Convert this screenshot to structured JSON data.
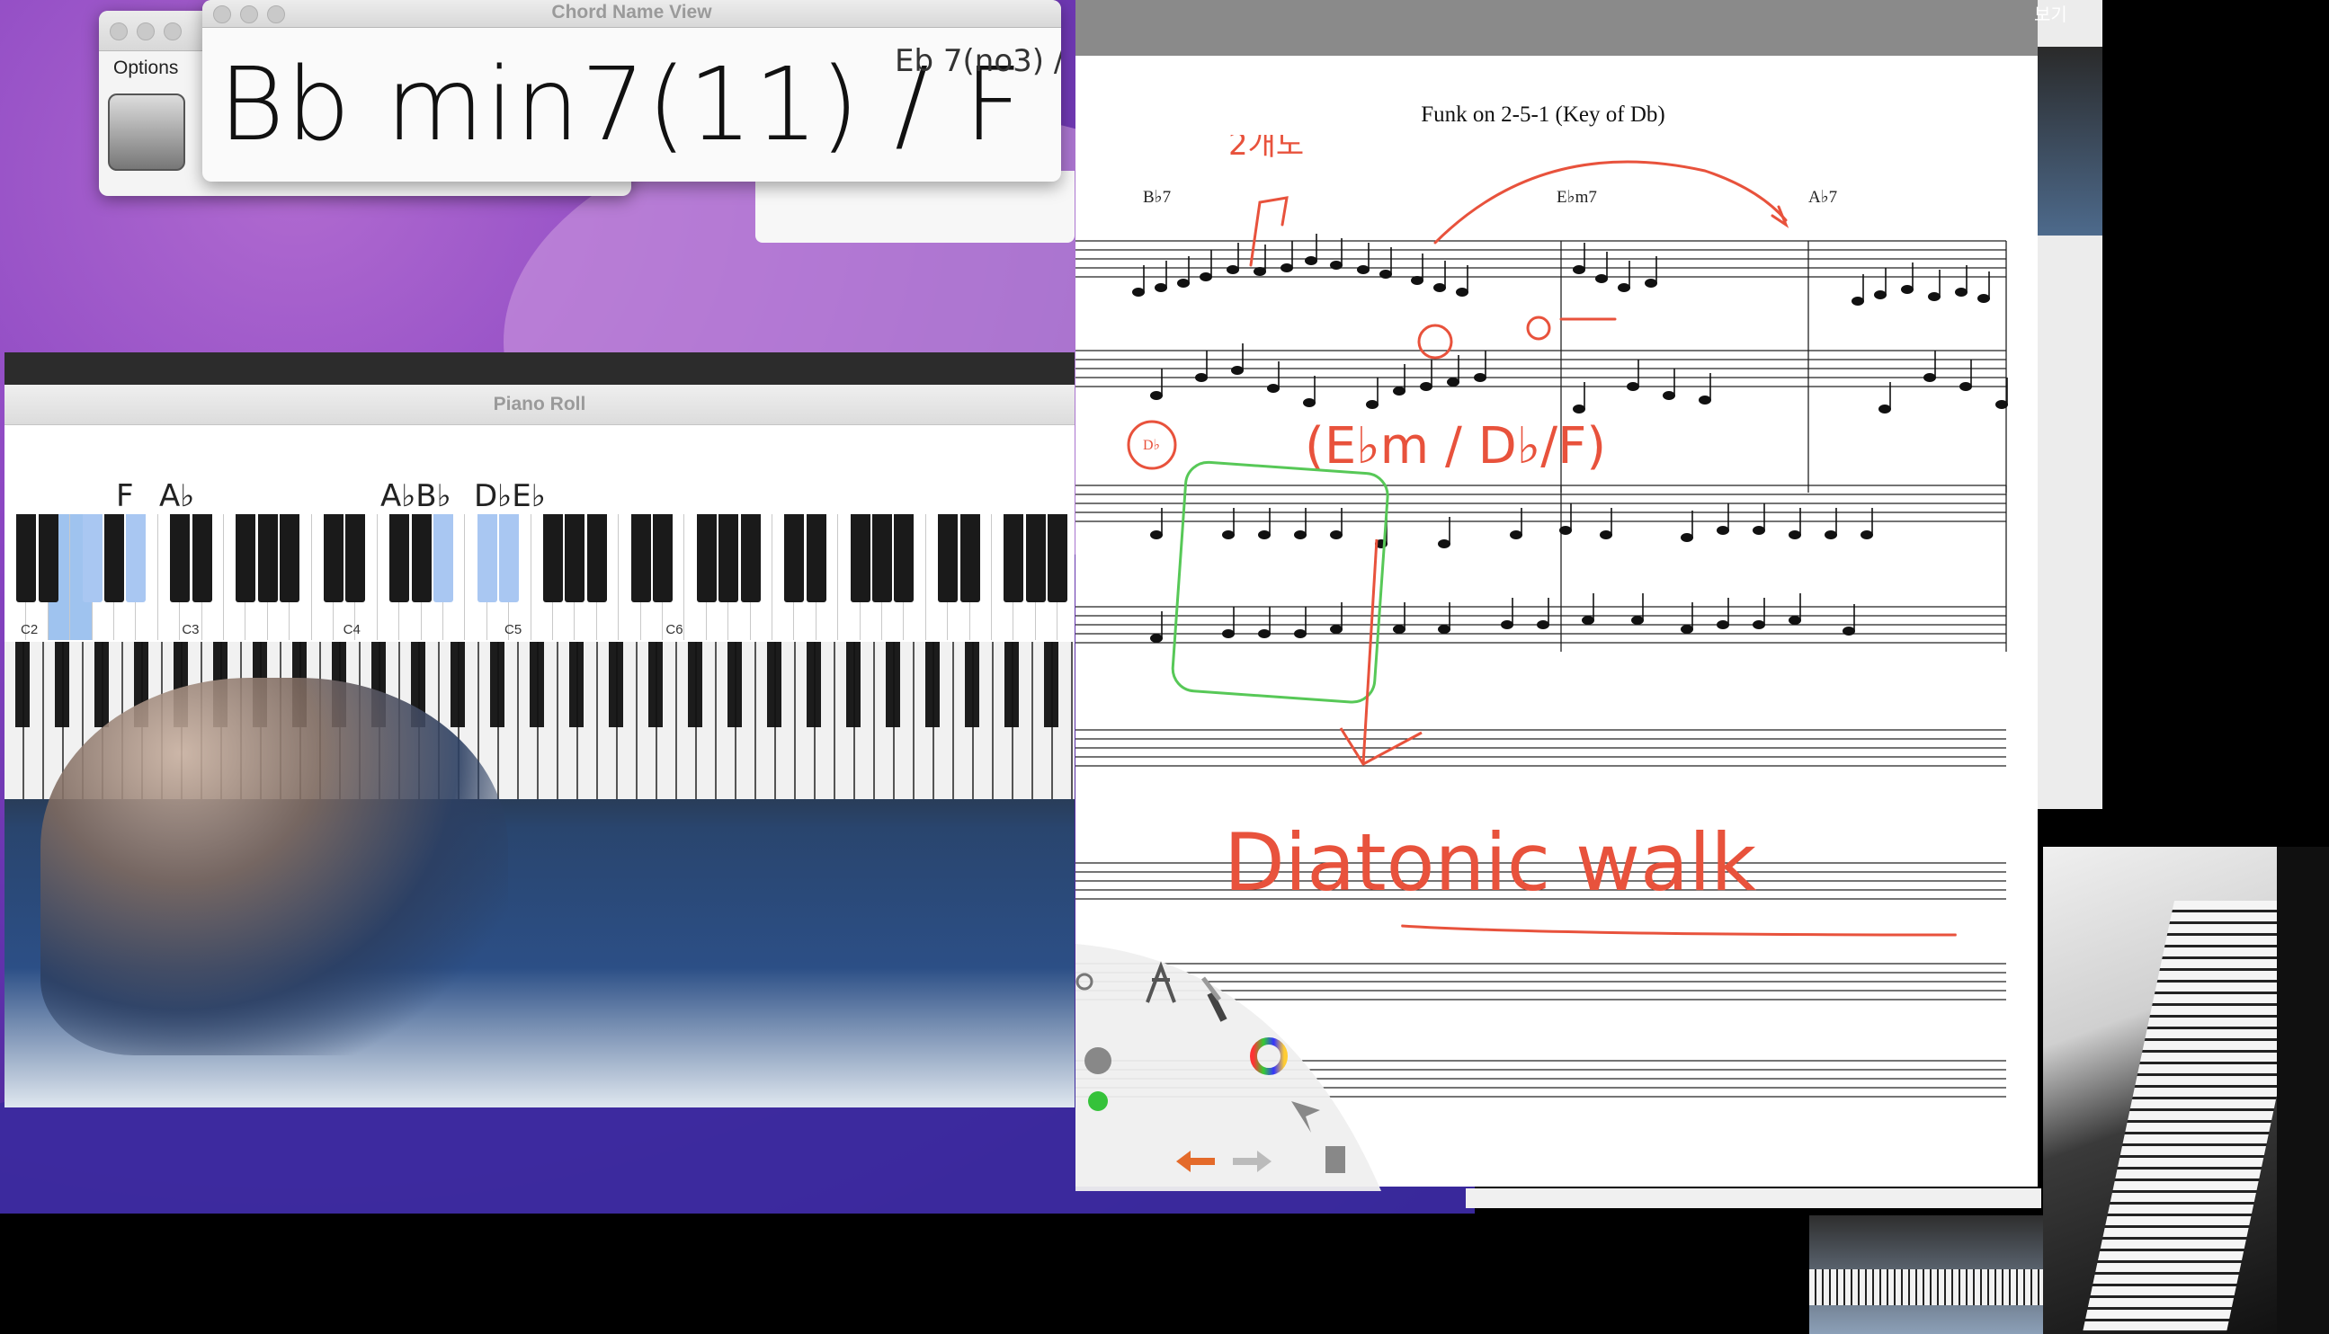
{
  "chord_window": {
    "title": "Chord Name View",
    "options_label": "Options",
    "current_chord": "Bb min7(11) / F",
    "next_chord": "Eb 7(no3) /"
  },
  "piano_roll": {
    "title": "Piano Roll",
    "octave_labels": [
      "C2",
      "C3",
      "C4",
      "C5",
      "C6"
    ],
    "note_labels": [
      "F",
      "A♭",
      "A♭B♭",
      "D♭E♭"
    ],
    "highlight_color": "#9fc3ef"
  },
  "score": {
    "title": "Funk on 2-5-1 (Key of Db)",
    "chord_symbols": [
      "B♭7",
      "E♭m7",
      "A♭7"
    ],
    "bass_label": "D♭",
    "annotations": {
      "korean": "2개도",
      "chord_note": "(E♭m / D♭/F)",
      "walk_text": "Diatonic walk"
    },
    "annotation_color": "#e8523c",
    "highlight_box_color": "#57c857"
  },
  "right_panel": {
    "label": "보기"
  },
  "toolbar": {
    "tools": [
      "settings-icon",
      "easel-icon",
      "brush-icon",
      "color-wheel-icon",
      "pointer-icon",
      "metronome-icon",
      "undo-icon",
      "redo-icon",
      "trash-icon"
    ]
  }
}
